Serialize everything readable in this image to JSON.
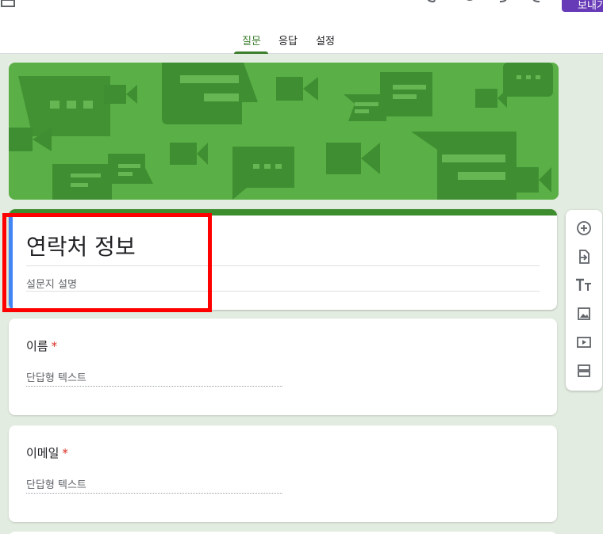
{
  "toolbar": {
    "send_label": "보내기",
    "icons": [
      "palette-icon",
      "preview-eye-icon",
      "undo-icon",
      "redo-icon"
    ]
  },
  "tabs": [
    {
      "label": "질문",
      "active": true
    },
    {
      "label": "응답",
      "active": false
    },
    {
      "label": "설정",
      "active": false
    }
  ],
  "form": {
    "title": "연락처 정보",
    "description_placeholder": "설문지 설명"
  },
  "questions": [
    {
      "label": "이름",
      "required_mark": "*",
      "answer_hint": "단답형 텍스트"
    },
    {
      "label": "이메일",
      "required_mark": "*",
      "answer_hint": "단답형 텍스트"
    }
  ],
  "side_toolbar": [
    "add-question-icon",
    "import-questions-icon",
    "add-title-icon",
    "add-image-icon",
    "add-video-icon",
    "add-section-icon"
  ],
  "colors": {
    "accent_green": "#3c7e2e",
    "banner_green": "#5ab046",
    "send_purple": "#673ab7",
    "highlight_red": "#ff0000",
    "required_red": "#d93025"
  }
}
